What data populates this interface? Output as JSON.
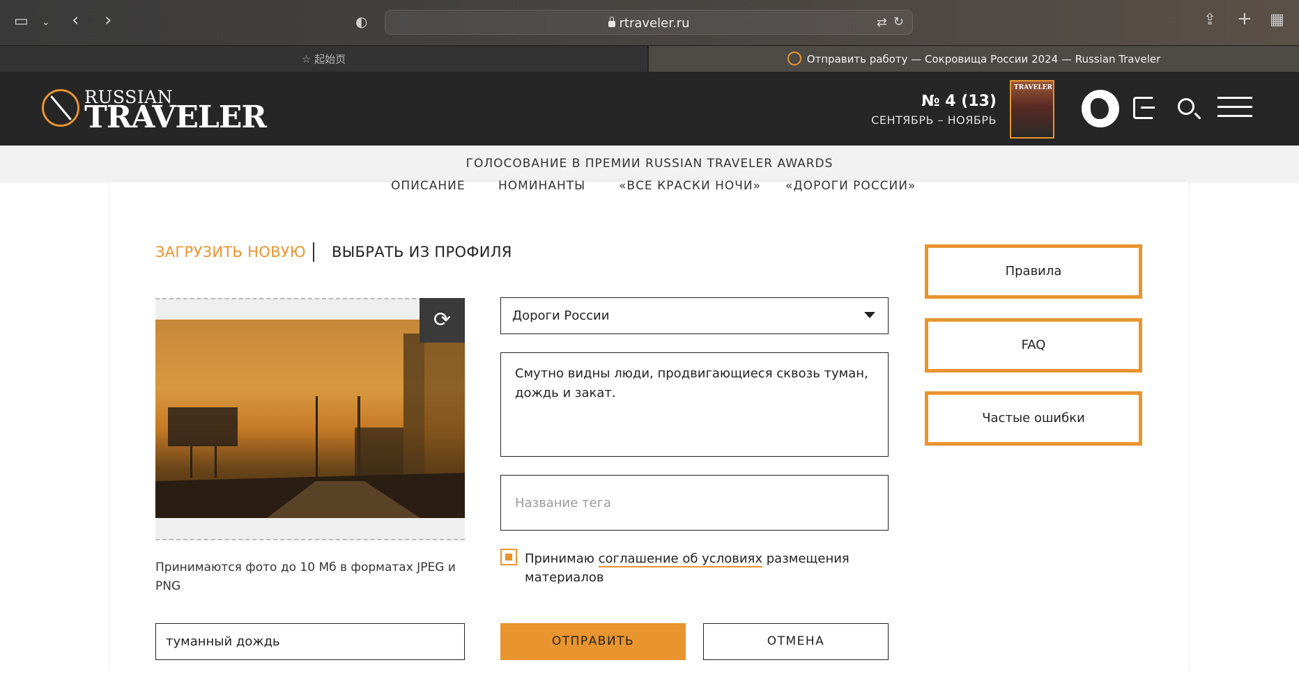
{
  "browser": {
    "url": "rtraveler.ru",
    "tabs": [
      {
        "label": "起始页",
        "active": false
      },
      {
        "label": "Отправить работу — Сокровища России 2024 — Russian Traveler",
        "active": true
      }
    ]
  },
  "header": {
    "logo_small": "RUSSIAN",
    "logo_big": "TRAVELER",
    "issue_number": "№ 4 (13)",
    "issue_period": "СЕНТЯБРЬ – НОЯБРЬ",
    "cover_label": "TRAVELER"
  },
  "awards_bar": {
    "title": "ГОЛОСОВАНИЕ В ПРЕМИИ RUSSIAN TRAVELER AWARDS"
  },
  "subnav": [
    "ОПИСАНИЕ",
    "НОМИНАНТЫ",
    "«ВСЕ КРАСКИ НОЧИ»",
    "«ДОРОГИ РОССИИ»"
  ],
  "upload": {
    "tab_new": "ЗАГРУЗИТЬ НОВУЮ",
    "tab_profile": "ВЫБРАТЬ ИЗ ПРОФИЛЯ",
    "hint": "Принимаются фото до 10 Мб в форматах JPEG и PNG",
    "tag_value": "туманный дождь"
  },
  "form": {
    "category": "Дороги России",
    "description": "Смутно видны люди, продвигающиеся сквозь туман, дождь и закат.",
    "tag_placeholder": "Название тега",
    "agree_before": "Принимаю ",
    "agree_link": "соглашение об условиях",
    "agree_after": " размещения материалов",
    "submit_label": "ОТПРАВИТЬ",
    "cancel_label": "ОТМЕНА"
  },
  "sidebar": {
    "buttons": [
      "Правила",
      "FAQ",
      "Частые ошибки"
    ]
  },
  "colors": {
    "accent": "#e8942f",
    "header_bg": "#262626"
  }
}
